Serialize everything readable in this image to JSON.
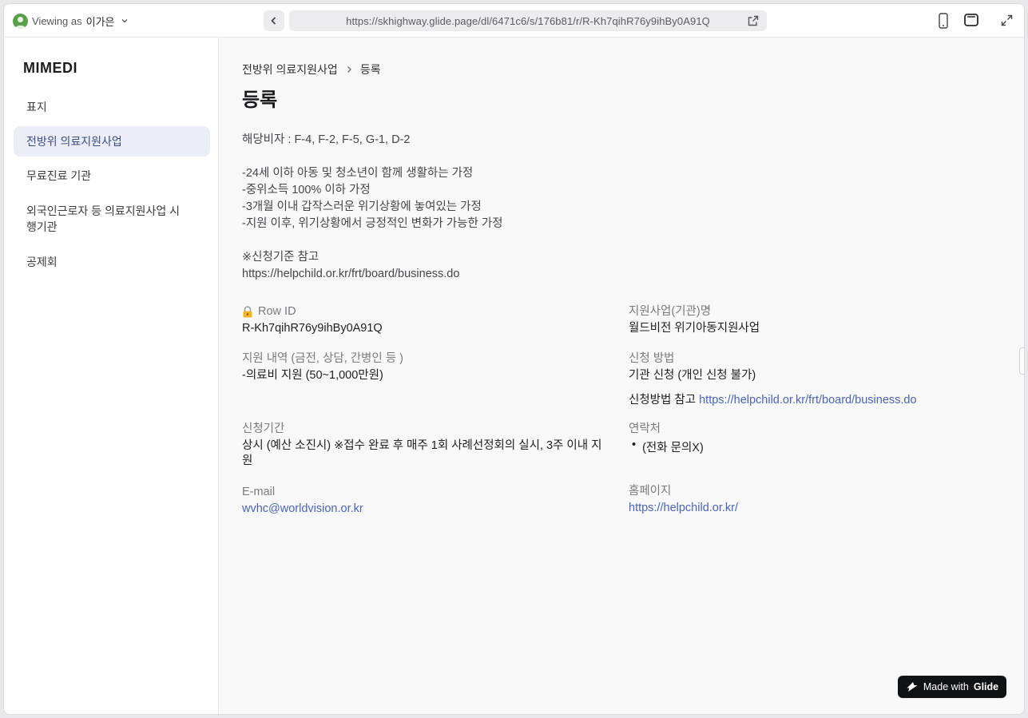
{
  "topbar": {
    "viewing_prefix": "Viewing as",
    "viewing_user": "이가은",
    "url": "https://skhighway.glide.page/dl/6471c6/s/176b81/r/R-Kh7qihR76y9ihBy0A91Q"
  },
  "sidebar": {
    "app_title": "MIMEDI",
    "items": [
      {
        "label": "표지",
        "active": false
      },
      {
        "label": "전방위 의료지원사업",
        "active": true
      },
      {
        "label": "무료진료 기관",
        "active": false
      },
      {
        "label": "외국인근로자 등 의료지원사업 시\n행기관",
        "active": false
      },
      {
        "label": "공제회",
        "active": false
      }
    ]
  },
  "main": {
    "breadcrumb": {
      "parent": "전방위 의료지원사업",
      "current": "등록"
    },
    "title": "등록",
    "description": "해당비자 : F-4, F-2, F-5, G-1, D-2\n\n-24세 이하 아동 및 청소년이 함께 생활하는 가정\n-중위소득 100% 이하 가정\n-3개월 이내 갑작스러운 위기상황에 놓여있는 가정\n-지원 이후, 위기상황에서 긍정적인 변화가 가능한 가정\n\n※신청기준 참고\nhttps://helpchild.or.kr/frt/board/business.do",
    "fields": {
      "row_id": {
        "label": "Row ID",
        "value": "R-Kh7qihR76y9ihBy0A91Q"
      },
      "program_name": {
        "label": "지원사업(기관)명",
        "value": "월드비전 위기아동지원사업"
      },
      "support_detail": {
        "label": "지원 내역 (금전, 상담, 간병인 등 )",
        "value": "-의료비 지원 (50~1,000만원)"
      },
      "apply_method": {
        "label": "신청 방법",
        "value": "기관 신청 (개인 신청 불가)",
        "note_prefix": "신청방법 참고",
        "note_link": "https://helpchild.or.kr/frt/board/business.do"
      },
      "apply_period": {
        "label": "신청기간",
        "value": "상시 (예산 소진시) ※접수 완료 후 매주 1회 사례선정회의 실시, 3주 이내 지원"
      },
      "contact": {
        "label": "연락처",
        "items": [
          "(전화 문의X)"
        ]
      },
      "email": {
        "label": "E-mail",
        "value": "wvhc@worldvision.or.kr"
      },
      "homepage": {
        "label": "홈페이지",
        "value": "https://helpchild.or.kr/"
      }
    }
  },
  "badge": {
    "prefix": "Made with",
    "brand": "Glide"
  },
  "colors": {
    "accent": "#4a64b8",
    "active_nav_bg": "#eceef7",
    "avatar": "#5aa04a"
  }
}
